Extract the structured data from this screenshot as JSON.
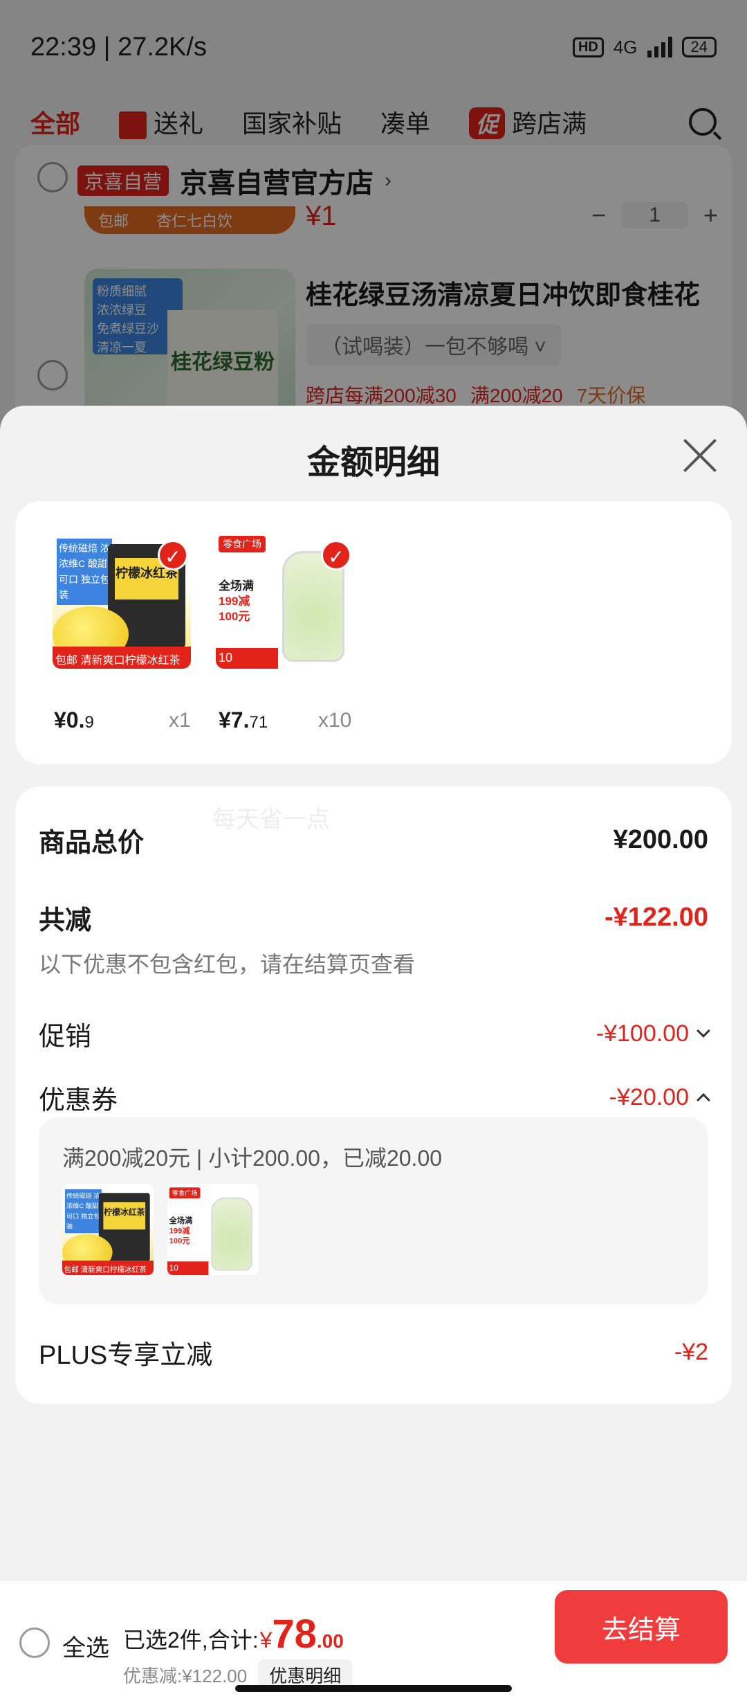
{
  "status": {
    "time": "22:39 | 27.2K/s",
    "hd": "HD",
    "network": "4G",
    "battery": "24"
  },
  "tabs": [
    {
      "label": "全部"
    },
    {
      "label": "送礼"
    },
    {
      "label": "国家补贴"
    },
    {
      "label": "凑单"
    },
    {
      "label": "跨店满",
      "badge": "促"
    }
  ],
  "store": {
    "badge": "京喜自营",
    "name": "京喜自营官方店",
    "chevron": "›"
  },
  "prev_item": {
    "tag": "包邮",
    "tag2": "杏仁七白饮",
    "price": "¥1",
    "minus": "−",
    "qty": "1",
    "plus": "+"
  },
  "item": {
    "title": "桂花绿豆汤清凉夏日冲饮即食桂花",
    "spec": "（试喝装）一包不够喝 ˅",
    "promo1": "跨店每满200减30",
    "promo2": "满200减20",
    "promo3": "7天价保",
    "img_tags": "粉质细腻\n浓浓绿豆\n免煮绿豆沙\n清凉一夏",
    "img_box": "桂花绿豆粉"
  },
  "sheet": {
    "title": "金额明细",
    "watermark": "每天省一点",
    "products": [
      {
        "price_main": "¥0.",
        "price_dec": "9",
        "qty": "x1"
      },
      {
        "price_main": "¥7.",
        "price_dec": "71",
        "qty": "x10"
      }
    ],
    "img_lemon": {
      "tags": "传统磁焙 浓浓维C 酸甜可口 独立包装",
      "label": "柠檬冰红茶",
      "bottom": "包邮 清新爽口柠檬冰红茶"
    },
    "img_candy": {
      "logo": "零食广场",
      "line1": "全场满",
      "line2": "199减",
      "line3": "100元",
      "bottom": "10"
    },
    "total": {
      "label": "商品总价",
      "value": "¥200.00"
    },
    "saved": {
      "label": "共减",
      "value": "-¥122.00",
      "note": "以下优惠不包含红包，请在结算页查看"
    },
    "promo": {
      "label": "促销",
      "value": "-¥100.00"
    },
    "coupon": {
      "label": "优惠券",
      "value": "-¥20.00",
      "detail": "满200减20元 | 小计200.00，已减20.00"
    },
    "plus": {
      "label": "PLUS专享立减",
      "value": "-¥2"
    }
  },
  "bottom_bar": {
    "select_all": "全选",
    "selected": "已选2件,合计:",
    "currency": "¥",
    "total_int": "78",
    "total_dec": ".00",
    "discount": "优惠减:¥122.00",
    "detail_btn": "优惠明细",
    "checkout": "去结算"
  },
  "colors": {
    "accent": "#e2231a",
    "checkout": "#f03c3c"
  }
}
